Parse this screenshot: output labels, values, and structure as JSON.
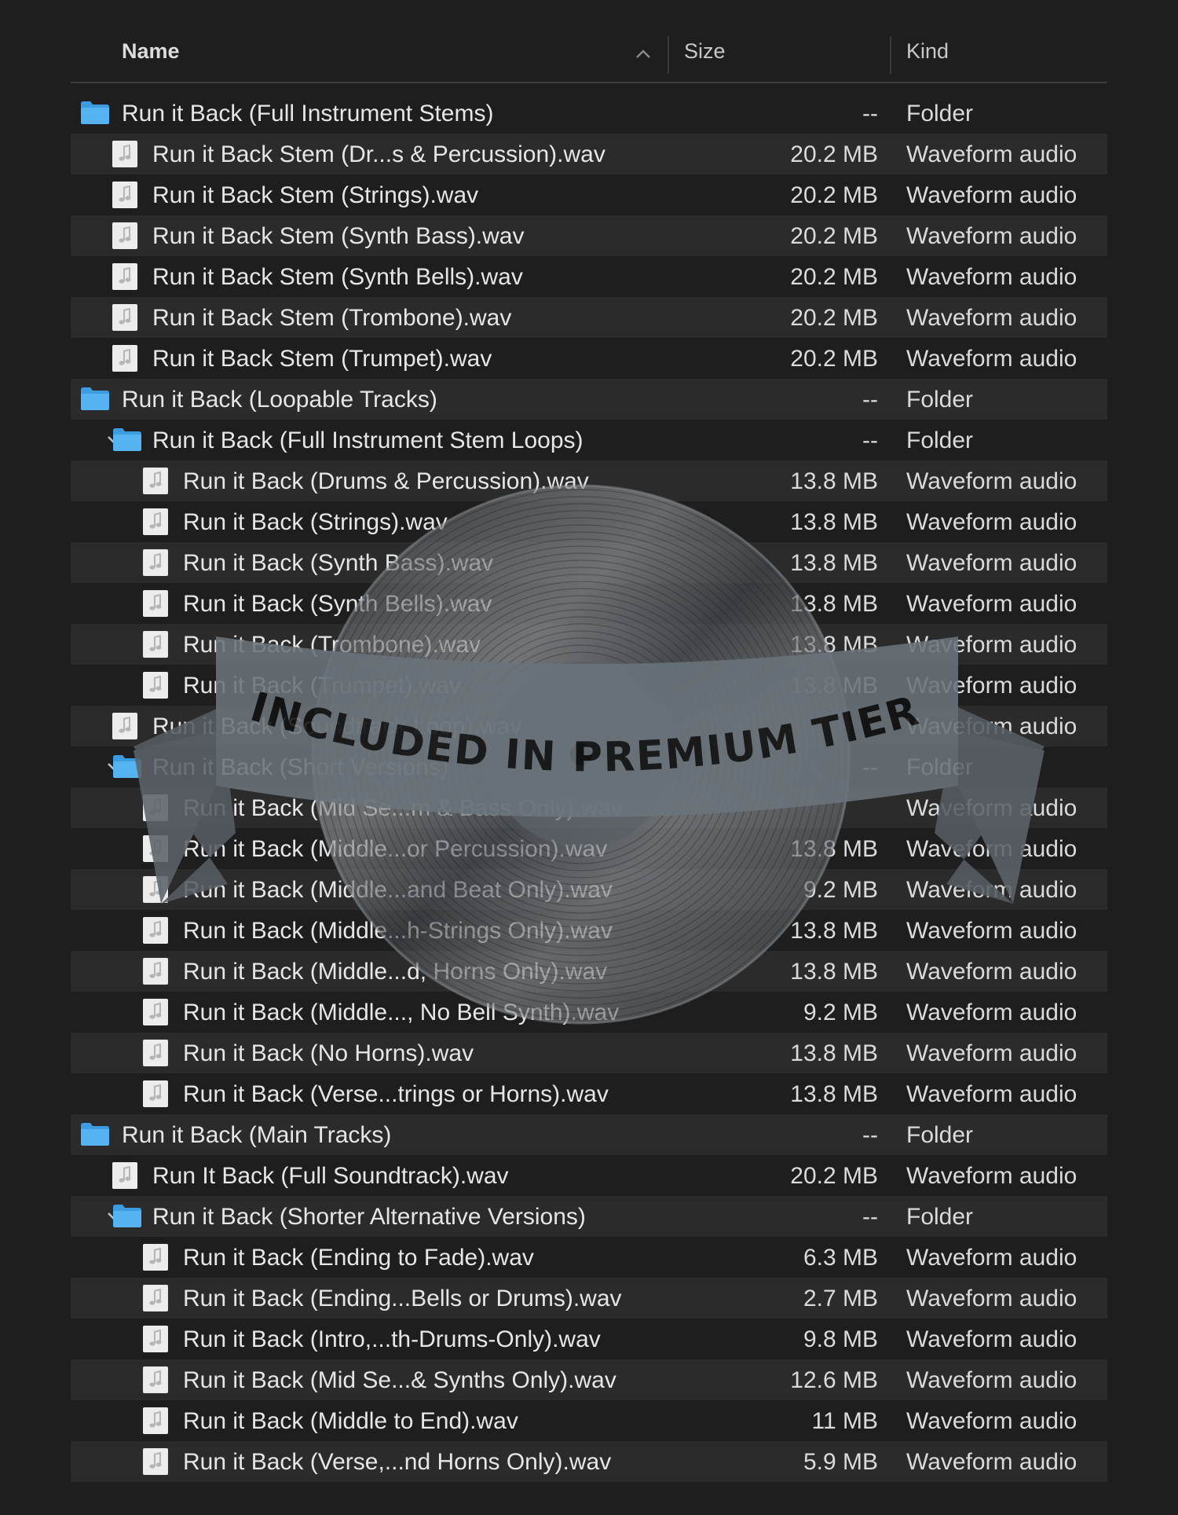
{
  "columns": {
    "name": "Name",
    "size": "Size",
    "kind": "Kind"
  },
  "rows": [
    {
      "level": 0,
      "type": "folder",
      "expanded": false,
      "name": "Run it Back (Full Instrument Stems)",
      "size": "--",
      "kind": "Folder"
    },
    {
      "level": 1,
      "type": "file",
      "name": "Run it Back Stem (Dr...s & Percussion).wav",
      "size": "20.2 MB",
      "kind": "Waveform audio"
    },
    {
      "level": 1,
      "type": "file",
      "name": "Run it Back Stem (Strings).wav",
      "size": "20.2 MB",
      "kind": "Waveform audio"
    },
    {
      "level": 1,
      "type": "file",
      "name": "Run it Back Stem (Synth Bass).wav",
      "size": "20.2 MB",
      "kind": "Waveform audio"
    },
    {
      "level": 1,
      "type": "file",
      "name": "Run it Back Stem (Synth Bells).wav",
      "size": "20.2 MB",
      "kind": "Waveform audio"
    },
    {
      "level": 1,
      "type": "file",
      "name": "Run it Back Stem (Trombone).wav",
      "size": "20.2 MB",
      "kind": "Waveform audio"
    },
    {
      "level": 1,
      "type": "file",
      "name": "Run it Back Stem (Trumpet).wav",
      "size": "20.2 MB",
      "kind": "Waveform audio"
    },
    {
      "level": 0,
      "type": "folder",
      "expanded": false,
      "name": "Run it Back (Loopable Tracks)",
      "size": "--",
      "kind": "Folder"
    },
    {
      "level": 1,
      "type": "folder",
      "expanded": true,
      "name": "Run it Back (Full Instrument Stem Loops)",
      "size": "--",
      "kind": "Folder"
    },
    {
      "level": 2,
      "type": "file",
      "name": "Run it Back (Drums & Percussion).wav",
      "size": "13.8 MB",
      "kind": "Waveform audio"
    },
    {
      "level": 2,
      "type": "file",
      "name": "Run it Back (Strings).wav",
      "size": "13.8 MB",
      "kind": "Waveform audio"
    },
    {
      "level": 2,
      "type": "file",
      "name": "Run it Back (Synth Bass).wav",
      "size": "13.8 MB",
      "kind": "Waveform audio"
    },
    {
      "level": 2,
      "type": "file",
      "name": "Run it Back (Synth Bells).wav",
      "size": "13.8 MB",
      "kind": "Waveform audio"
    },
    {
      "level": 2,
      "type": "file",
      "name": "Run it Back (Trombone).wav",
      "size": "13.8 MB",
      "kind": "Waveform audio"
    },
    {
      "level": 2,
      "type": "file",
      "name": "Run it Back (Trumpet).wav",
      "size": "13.8 MB",
      "kind": "Waveform audio"
    },
    {
      "level": 1,
      "type": "file",
      "name": "Run it Back (Soundtrack Loop).wav",
      "size": "",
      "kind": "Waveform audio"
    },
    {
      "level": 1,
      "type": "folder",
      "expanded": true,
      "name": "Run it Back (Short Versions)",
      "size": "--",
      "kind": "Folder"
    },
    {
      "level": 2,
      "type": "file",
      "name": "Run it Back (Mid Se...m & Bass Only).wav",
      "size": "",
      "kind": "Waveform audio"
    },
    {
      "level": 2,
      "type": "file",
      "name": "Run it Back (Middle...or Percussion).wav",
      "size": "13.8 MB",
      "kind": "Waveform audio"
    },
    {
      "level": 2,
      "type": "file",
      "name": "Run it Back (Middle...and Beat Only).wav",
      "size": "9.2 MB",
      "kind": "Waveform audio"
    },
    {
      "level": 2,
      "type": "file",
      "name": "Run it Back (Middle...h-Strings Only).wav",
      "size": "13.8 MB",
      "kind": "Waveform audio"
    },
    {
      "level": 2,
      "type": "file",
      "name": "Run it Back (Middle...d, Horns Only).wav",
      "size": "13.8 MB",
      "kind": "Waveform audio"
    },
    {
      "level": 2,
      "type": "file",
      "name": "Run it Back (Middle..., No Bell Synth).wav",
      "size": "9.2 MB",
      "kind": "Waveform audio"
    },
    {
      "level": 2,
      "type": "file",
      "name": "Run it Back (No Horns).wav",
      "size": "13.8 MB",
      "kind": "Waveform audio"
    },
    {
      "level": 2,
      "type": "file",
      "name": "Run it Back (Verse...trings or Horns).wav",
      "size": "13.8 MB",
      "kind": "Waveform audio"
    },
    {
      "level": 0,
      "type": "folder",
      "expanded": false,
      "name": "Run it Back (Main Tracks)",
      "size": "--",
      "kind": "Folder"
    },
    {
      "level": 1,
      "type": "file",
      "name": "Run It Back (Full Soundtrack).wav",
      "size": "20.2 MB",
      "kind": "Waveform audio"
    },
    {
      "level": 1,
      "type": "folder",
      "expanded": true,
      "name": "Run it Back (Shorter Alternative Versions)",
      "size": "--",
      "kind": "Folder"
    },
    {
      "level": 2,
      "type": "file",
      "name": "Run it Back (Ending to Fade).wav",
      "size": "6.3 MB",
      "kind": "Waveform audio"
    },
    {
      "level": 2,
      "type": "file",
      "name": "Run it Back (Ending...Bells or Drums).wav",
      "size": "2.7 MB",
      "kind": "Waveform audio"
    },
    {
      "level": 2,
      "type": "file",
      "name": "Run it Back (Intro,...th-Drums-Only).wav",
      "size": "9.8 MB",
      "kind": "Waveform audio"
    },
    {
      "level": 2,
      "type": "file",
      "name": "Run it Back (Mid Se...& Synths Only).wav",
      "size": "12.6 MB",
      "kind": "Waveform audio"
    },
    {
      "level": 2,
      "type": "file",
      "name": "Run it Back (Middle to End).wav",
      "size": "11 MB",
      "kind": "Waveform audio"
    },
    {
      "level": 2,
      "type": "file",
      "name": "Run it Back (Verse,...nd Horns Only).wav",
      "size": "5.9 MB",
      "kind": "Waveform audio"
    }
  ],
  "overlay": {
    "banner_text": "INCLUDED IN PREMIUM TIER"
  },
  "colors": {
    "background": "#1e1e1e",
    "row_alt": "#2b2b2b",
    "folder": "#4aa8e8",
    "text": "#e6e6e6",
    "banner": "#6b747b"
  },
  "icons": {
    "folder": "folder-icon",
    "file": "audio-file-icon",
    "disclosure": "chevron-down-icon",
    "sort": "chevron-up-icon"
  }
}
